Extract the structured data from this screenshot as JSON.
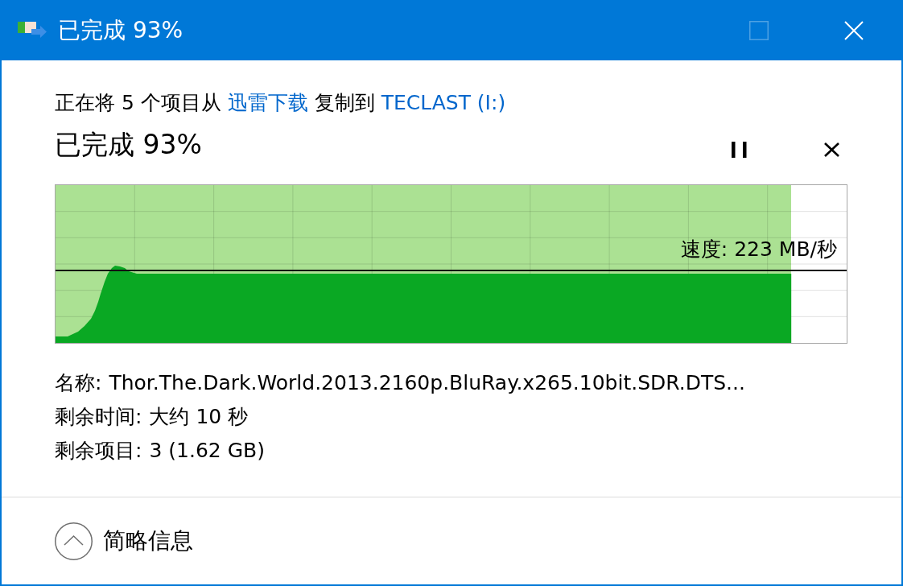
{
  "window": {
    "title": "已完成 93%",
    "buttons": [
      {
        "kind": "maximize",
        "disabled": true
      },
      {
        "kind": "close",
        "disabled": false
      }
    ]
  },
  "summary": [
    {
      "kind": "text",
      "text": "正在将 5 个项目从 "
    },
    {
      "kind": "link",
      "text": "迅雷下载"
    },
    {
      "kind": "text",
      "text": " 复制到 "
    },
    {
      "kind": "link",
      "text": "TECLAST (I:)"
    }
  ],
  "progress": {
    "text": "已完成 93%",
    "controls": [
      {
        "kind": "pause"
      },
      {
        "kind": "cancel"
      }
    ]
  },
  "graph": {
    "level": 0.93,
    "speed": "速度: 223 MB/秒"
  },
  "details": [
    {
      "label": "名称:",
      "value": "Thor.The.Dark.World.2013.2160p.BluRay.x265.10bit.SDR.DTS..."
    },
    {
      "label": "剩余时间:",
      "value": "大约 10 秒"
    },
    {
      "label": "剩余项目:",
      "value": "3 (1.62 GB)"
    }
  ],
  "footer": {
    "label": "简略信息",
    "expanded": true
  }
}
